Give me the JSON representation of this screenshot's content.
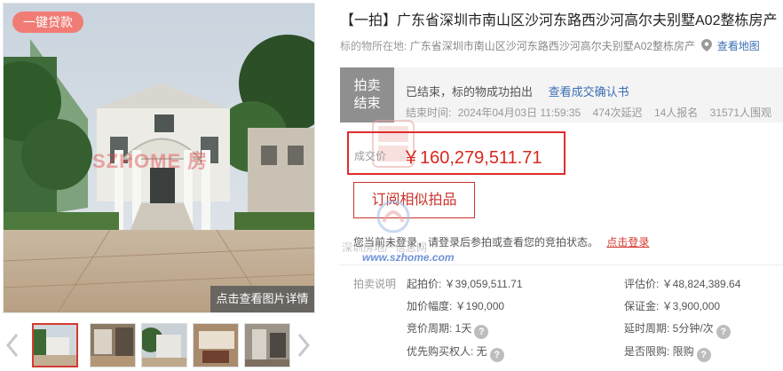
{
  "gallery": {
    "badge": "一键贷款",
    "view_details": "点击查看图片详情",
    "watermark": "SZHOME 房",
    "thumbnail_count": 5
  },
  "title": "【一拍】广东省深圳市南山区沙河东路西沙河高尔夫别墅A02整栋房产",
  "location": {
    "label": "标的物所在地:",
    "address": "广东省深圳市南山区沙河东路西沙河高尔夫别墅A02整栋房产",
    "map_link": "查看地图"
  },
  "status": {
    "tag_line1": "拍卖",
    "tag_line2": "结束",
    "text": "已结束，标的物成功拍出",
    "confirm_link": "查看成交确认书",
    "end_time_label": "结束时间:",
    "end_time": "2024年04月03日 11:59:35",
    "delays": "474次延迟",
    "signups": "14人报名",
    "views": "31571人围观"
  },
  "price": {
    "label": "成交价",
    "value": "￥160,279,511.71"
  },
  "subscribe_button": "订阅相似拍品",
  "login_tip": {
    "text": "您当前未登录，请登录后参拍或查看您的竞拍状态。",
    "link": "点击登录"
  },
  "watermark": {
    "site": "深圳房地产信息网",
    "url": "www.szhome.com",
    "stamp": "咚咚找房"
  },
  "auction_info": {
    "section_label": "拍卖说明",
    "starting_price": "起拍价: ￥39,059,511.71",
    "appraisal": "评估价: ￥48,824,389.64",
    "increment": "加价幅度: ￥190,000",
    "deposit": "保证金: ￥3,900,000",
    "bidding_period": "竞价周期: 1天",
    "extension_period": "延时周期: 5分钟/次",
    "priority_buyer": "优先购买权人: 无",
    "purchase_restricted": "是否限购: 限购"
  },
  "colors": {
    "accent_red": "#d8281f",
    "link_blue": "#3b6fb6",
    "badge": "#f07c75",
    "status_gray": "#8f8f8f"
  }
}
